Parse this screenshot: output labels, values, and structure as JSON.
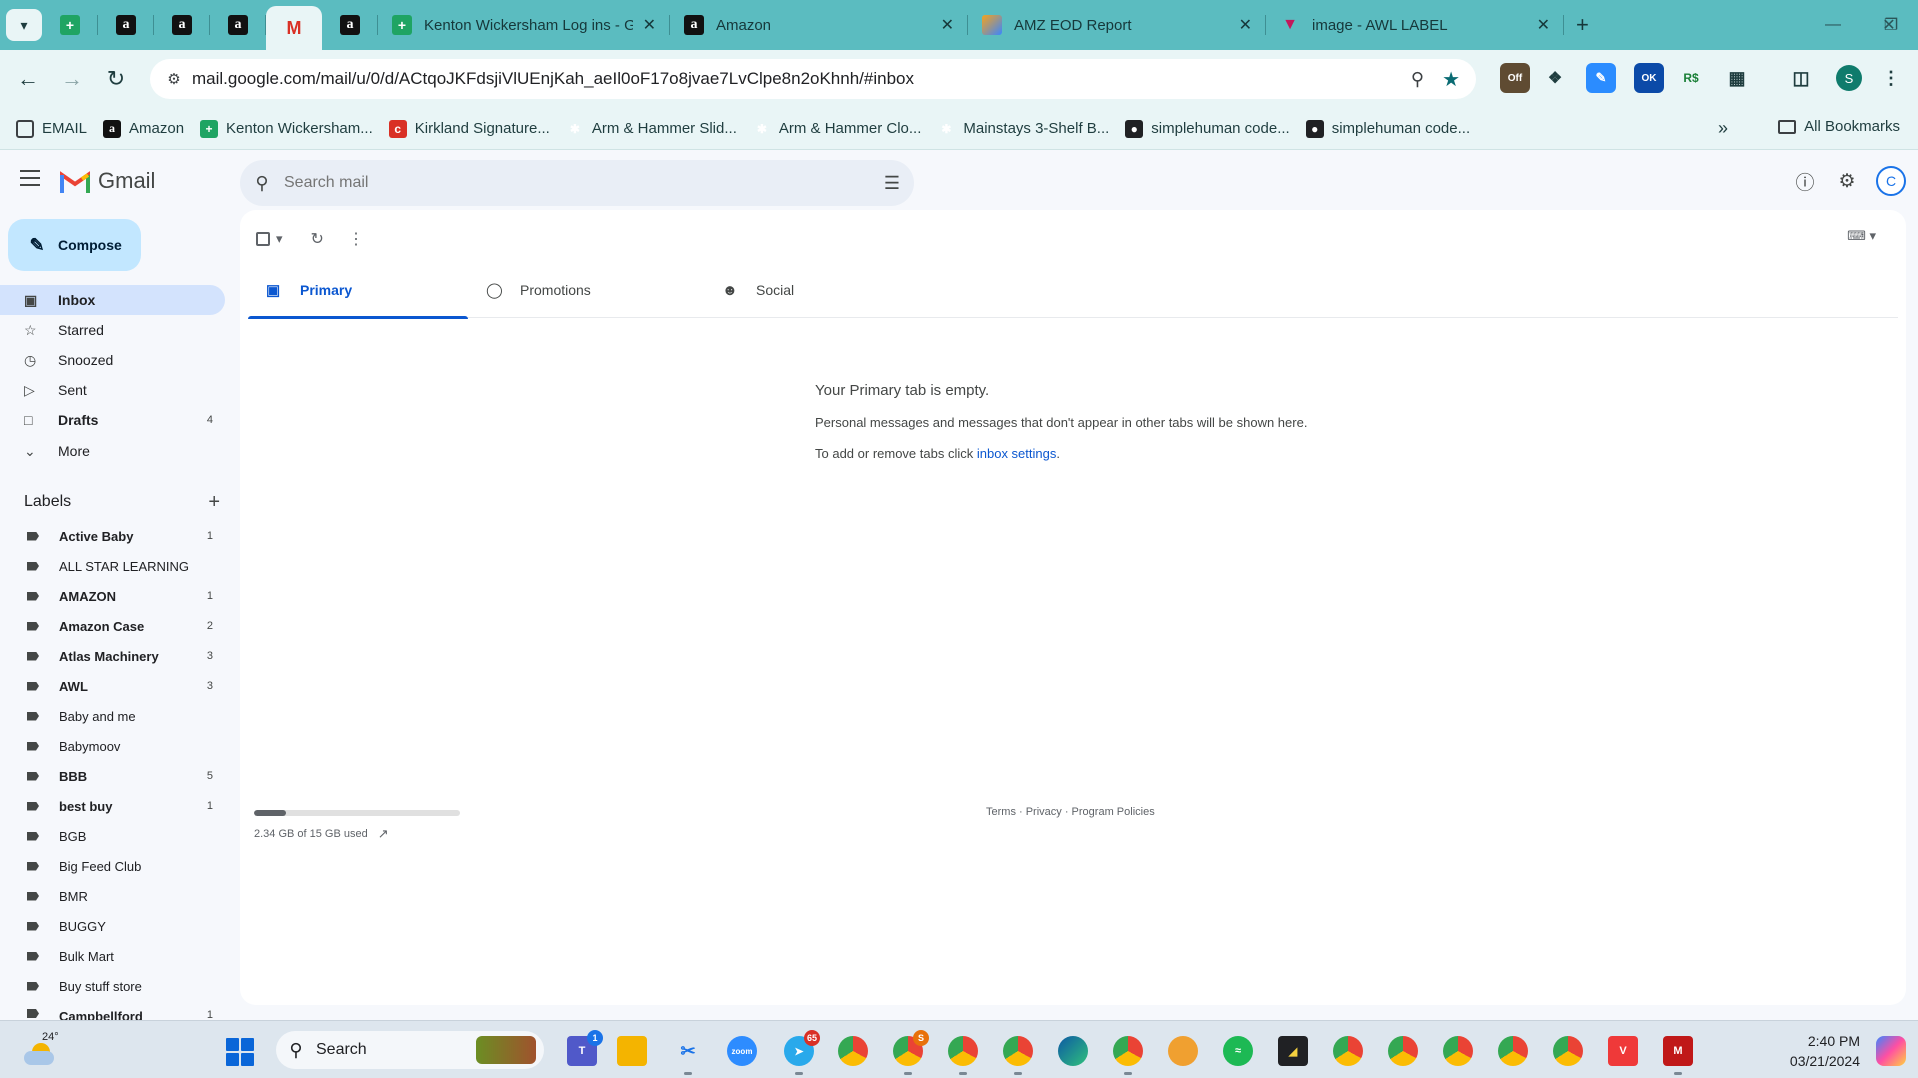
{
  "browser": {
    "tabs": [
      {
        "title": "Kenton Wickersham Log ins - G"
      },
      {
        "title": "Amazon"
      },
      {
        "title": "AMZ EOD Report"
      },
      {
        "title": "image - AWL LABEL"
      }
    ],
    "url": "mail.google.com/mail/u/0/d/ACtqoJKFdsjiVlUEnjKah_aeIl0oF17o8jvae7LvClpe8n2oKhnh/#inbox",
    "extensions": {
      "off_badge": "Off",
      "ok_badge": "OK",
      "rs_badge": "R$"
    },
    "profile_initial": "S",
    "bookmarks": [
      {
        "label": "EMAIL"
      },
      {
        "label": "Amazon"
      },
      {
        "label": "Kenton Wickersham..."
      },
      {
        "label": "Kirkland Signature..."
      },
      {
        "label": "Arm & Hammer Slid..."
      },
      {
        "label": "Arm & Hammer Clo..."
      },
      {
        "label": "Mainstays 3-Shelf B..."
      },
      {
        "label": "simplehuman code..."
      },
      {
        "label": "simplehuman code..."
      }
    ],
    "all_bookmarks": "All Bookmarks"
  },
  "gmail": {
    "logo_text": "Gmail",
    "search_placeholder": "Search mail",
    "account_initial": "C",
    "compose": "Compose",
    "nav": [
      {
        "label": "Inbox",
        "count": ""
      },
      {
        "label": "Starred",
        "count": ""
      },
      {
        "label": "Snoozed",
        "count": ""
      },
      {
        "label": "Sent",
        "count": ""
      },
      {
        "label": "Drafts",
        "count": "4"
      },
      {
        "label": "More",
        "count": ""
      }
    ],
    "labels_title": "Labels",
    "labels": [
      {
        "name": "Active Baby",
        "count": "1"
      },
      {
        "name": "ALL STAR LEARNING",
        "count": ""
      },
      {
        "name": "AMAZON",
        "count": "1"
      },
      {
        "name": "Amazon Case",
        "count": "2"
      },
      {
        "name": "Atlas Machinery",
        "count": "3"
      },
      {
        "name": "AWL",
        "count": "3"
      },
      {
        "name": "Baby and me",
        "count": ""
      },
      {
        "name": "Babymoov",
        "count": ""
      },
      {
        "name": "BBB",
        "count": "5"
      },
      {
        "name": "best buy",
        "count": "1"
      },
      {
        "name": "BGB",
        "count": ""
      },
      {
        "name": "Big Feed Club",
        "count": ""
      },
      {
        "name": "BMR",
        "count": ""
      },
      {
        "name": "BUGGY",
        "count": ""
      },
      {
        "name": "Bulk Mart",
        "count": ""
      },
      {
        "name": "Buy stuff store",
        "count": ""
      },
      {
        "name": "Campbellford",
        "count": "1"
      }
    ],
    "tabs": [
      {
        "label": "Primary"
      },
      {
        "label": "Promotions"
      },
      {
        "label": "Social"
      }
    ],
    "empty_title": "Your Primary tab is empty.",
    "empty_desc": "Personal messages and messages that don't appear in other tabs will be shown here.",
    "empty_hint_prefix": "To add or remove tabs click ",
    "empty_hint_link": "inbox settings",
    "empty_hint_suffix": ".",
    "storage_text": "2.34 GB of 15 GB used",
    "storage_fraction": 0.156,
    "footer": "Terms · Privacy · Program Policies"
  },
  "taskbar": {
    "temperature": "24°",
    "search": "Search",
    "teams_badge": "1",
    "telegram_badge": "65",
    "chrome_badge": "S",
    "time": "2:40 PM",
    "date": "03/21/2024"
  }
}
